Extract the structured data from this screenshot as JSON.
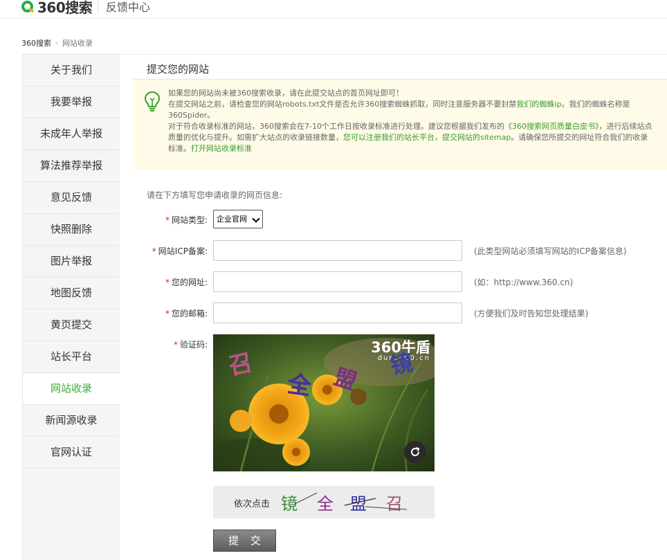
{
  "header": {
    "logo_text": "360搜索",
    "title": "反馈中心"
  },
  "breadcrumb": {
    "home": "360搜索",
    "separator": "›",
    "current": "网站收录"
  },
  "sidebar": {
    "items": [
      {
        "label": "关于我们",
        "active": false
      },
      {
        "label": "我要举报",
        "active": false
      },
      {
        "label": "未成年人举报",
        "active": false
      },
      {
        "label": "算法推荐举报",
        "active": false
      },
      {
        "label": "意见反馈",
        "active": false
      },
      {
        "label": "快照删除",
        "active": false
      },
      {
        "label": "图片举报",
        "active": false
      },
      {
        "label": "地图反馈",
        "active": false
      },
      {
        "label": "黄页提交",
        "active": false
      },
      {
        "label": "站长平台",
        "active": false
      },
      {
        "label": "网站收录",
        "active": true
      },
      {
        "label": "新闻源收录",
        "active": false
      },
      {
        "label": "官网认证",
        "active": false
      }
    ]
  },
  "main": {
    "title": "提交您的网站",
    "notice": {
      "line1": "如果您的网站尚未被360搜索收录，请在此提交站点的首页网址即可！",
      "line2_a": "在提交网站之前，请检查您的网站robots.txt文件是否允许360搜索蜘蛛抓取，同时注意服务器不要封禁",
      "line2_link": "我们的蜘蛛ip",
      "line2_b": "。我们的蜘蛛名称是360Spider。",
      "line3_a": "对于符合收录标准的网站，360搜索会在7-10个工作日按收录标准进行处理。建议您根据我们发布的",
      "line3_link1": "《360搜索网页质量白皮书》",
      "line3_b": "，进行后续站点质量的优化与提升。如需扩大站点的收录链接数量，",
      "line3_link2": "您可以注册我们的站长平台，提交网站的sitemap",
      "line3_c": "。请确保您所提交的网址符合我们的收录标准。",
      "line3_link3": "打开网站收录标准"
    },
    "form": {
      "intro": "请在下方填写您申请收录的网页信息:",
      "required_mark": "*",
      "site_type_label": "网站类型:",
      "site_type_value": "企业官网",
      "icp_label": "网站ICP备案:",
      "icp_value": "",
      "icp_hint": "(此类型网站必须填写网站的ICP备案信息)",
      "url_label": "您的网址:",
      "url_value": "",
      "url_hint": "(如：http://www.360.cn)",
      "email_label": "您的邮箱:",
      "email_value": "",
      "email_hint": "(方便我们及时告知您处理结果)",
      "captcha_label": "验证码:",
      "submit_label": "提 交"
    },
    "captcha": {
      "brand_big": "360牛盾",
      "brand_small": "dun.360.cn",
      "chars": [
        "召",
        "全",
        "盟",
        "镜"
      ],
      "order_label": "依次点击",
      "order_chars": [
        "镜",
        "全",
        "盟",
        "召"
      ],
      "refresh_icon": "refresh-icon"
    }
  },
  "colors": {
    "brand_green": "#1fae4c",
    "link_green": "#3a9c2d",
    "required_red": "#e1251b",
    "notice_bg": "#fffbe8"
  }
}
